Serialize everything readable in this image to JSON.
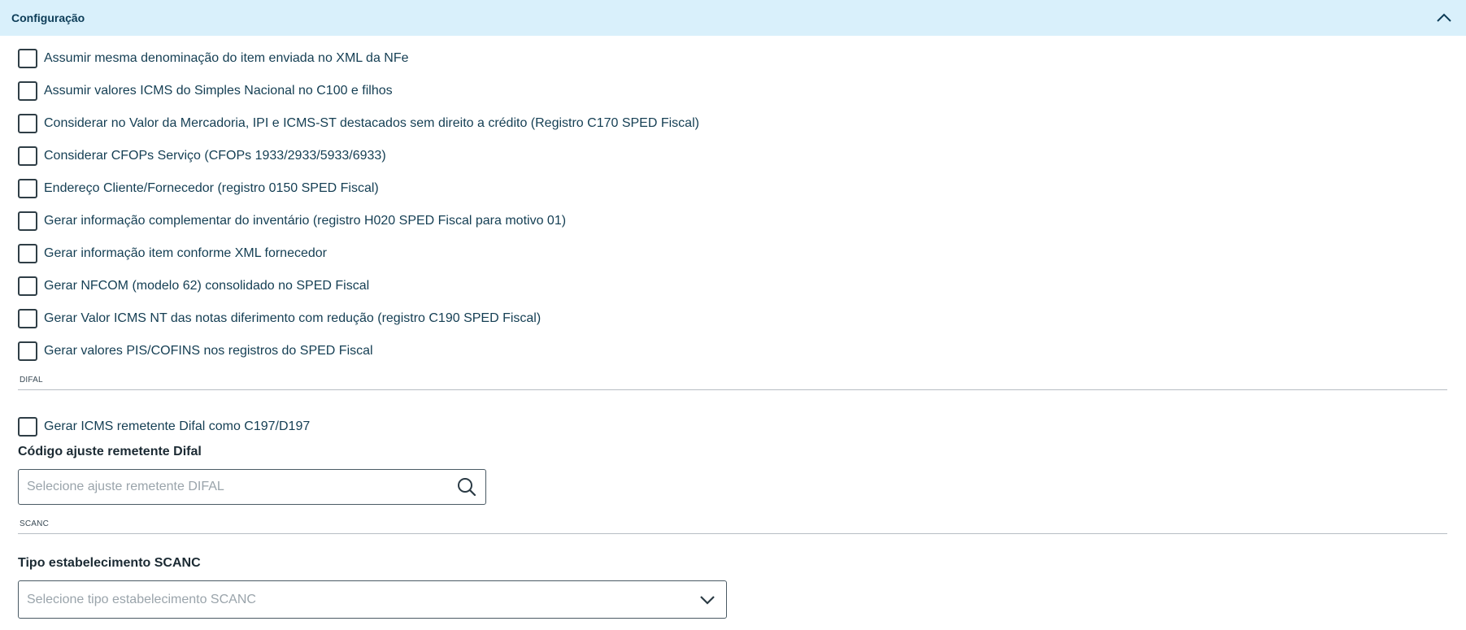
{
  "panel": {
    "title": "Configuração"
  },
  "checkboxes": [
    "Assumir mesma denominação do item enviada no XML da NFe",
    "Assumir valores ICMS do Simples Nacional no C100 e filhos",
    "Considerar no Valor da Mercadoria, IPI e ICMS-ST destacados sem direito a crédito (Registro C170 SPED Fiscal)",
    "Considerar CFOPs Serviço (CFOPs 1933/2933/5933/6933)",
    "Endereço Cliente/Fornecedor (registro 0150 SPED Fiscal)",
    "Gerar informação complementar do inventário (registro H020 SPED Fiscal para motivo 01)",
    "Gerar informação item conforme XML fornecedor",
    "Gerar NFCOM (modelo 62) consolidado no SPED Fiscal",
    "Gerar Valor ICMS NT das notas diferimento com redução (registro C190 SPED Fiscal)",
    "Gerar valores PIS/COFINS nos registros do SPED Fiscal"
  ],
  "difal": {
    "section_title": "DIFAL",
    "checkbox_label": "Gerar ICMS remetente Difal como C197/D197",
    "field_label": "Código ajuste remetente Difal",
    "field_value": "",
    "field_placeholder": "Selecione ajuste remetente DIFAL",
    "field_icon": "search-icon"
  },
  "scanc": {
    "section_title": "SCANC",
    "field_label": "Tipo estabelecimento SCANC",
    "field_value": "",
    "field_placeholder": "Selecione tipo estabelecimento SCANC",
    "field_icon": "chevron-down-icon"
  },
  "colors": {
    "header_bg": "#d9f0fb",
    "header_text": "#0c3c57",
    "text": "#143e53",
    "border": "#2f3e46"
  }
}
